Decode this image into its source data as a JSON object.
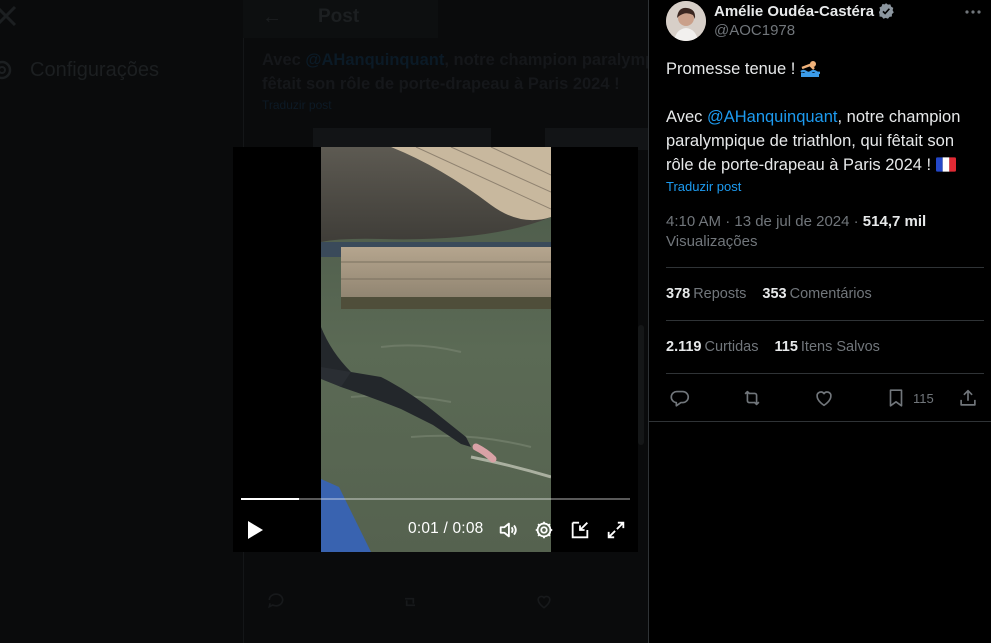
{
  "background": {
    "nav_settings_label": "Configurações",
    "header_title": "Post",
    "text_line1_prefix": "Avec ",
    "text_line1_mention": "@AHanquinquant",
    "text_line1_rest": ", notre champion paralymp",
    "text_line2": "fêtait son rôle de porte-drapeau à Paris 2024 !",
    "translate_label": "Traduzir post"
  },
  "video": {
    "time_display": "0:01 / 0:08",
    "progress_fraction": 0.15
  },
  "author": {
    "name": "Amélie Oudéa-Castéra",
    "handle": "@AOC1978"
  },
  "post": {
    "line1": "Promesse tenue !",
    "line2_prefix": "Avec ",
    "mention": "@AHanquinquant",
    "line2_rest": ", notre champion",
    "line3": "paralympique de triathlon, qui fêtait son",
    "line4": "rôle de porte-drapeau à Paris 2024 !",
    "translate_label": "Traduzir post",
    "timestamp": "4:10 AM · 13 de jul de 2024 · ",
    "views_count": "514,7 mil",
    "views_label": "Visualizações"
  },
  "stats": {
    "reposts_count": "378",
    "reposts_label": "Reposts",
    "comments_count": "353",
    "comments_label": "Comentários",
    "likes_count": "2.119",
    "likes_label": "Curtidas",
    "saves_count": "115",
    "saves_label": "Itens Salvos"
  },
  "actions": {
    "bookmark_count": "115"
  },
  "colors": {
    "accent": "#1d9bf0",
    "text_primary": "#e7e9ea",
    "text_secondary": "#71767b",
    "border": "#2f3336"
  }
}
